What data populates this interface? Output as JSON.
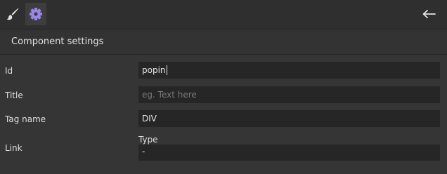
{
  "toolbar": {
    "tools": [
      {
        "icon": "paint-brush-icon"
      },
      {
        "icon": "gear-icon",
        "active": true
      }
    ],
    "back_icon": "arrow-left-icon"
  },
  "section": {
    "title": "Component settings"
  },
  "fields": {
    "id": {
      "label": "Id",
      "value": "popin"
    },
    "title": {
      "label": "Title",
      "value": "",
      "placeholder": "eg. Text here"
    },
    "tag_name": {
      "label": "Tag name",
      "value": "DIV"
    },
    "link": {
      "label": "Link",
      "type_label": "Type",
      "type_value": "-"
    }
  },
  "colors": {
    "accent": "#9a86e8",
    "background": "#353535",
    "input_bg": "#262626"
  }
}
